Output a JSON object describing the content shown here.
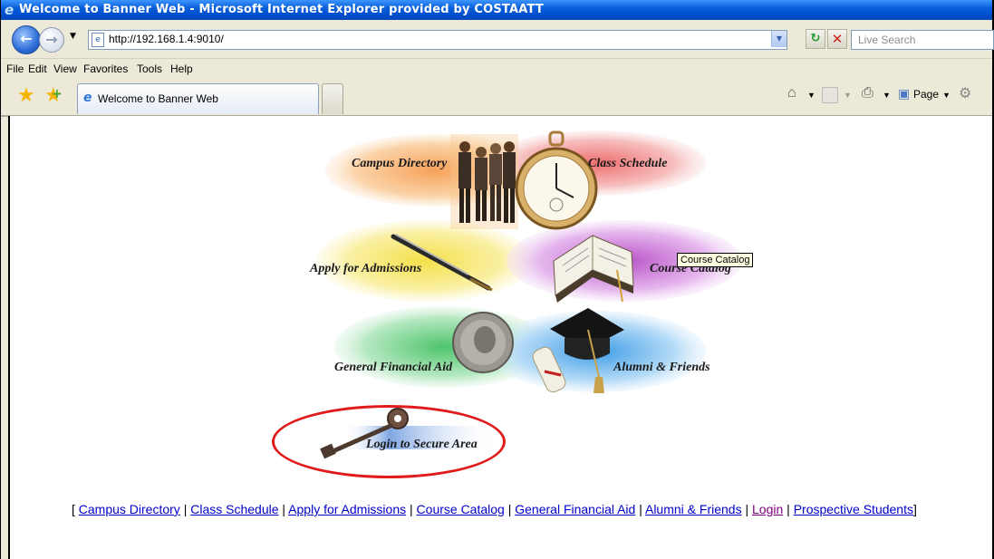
{
  "window": {
    "title": "Welcome to Banner Web - Microsoft Internet Explorer provided by COSTAATT"
  },
  "address_bar": {
    "url": "http://192.168.1.4:9010/"
  },
  "search": {
    "placeholder": "Live Search"
  },
  "menu": [
    {
      "label": "File"
    },
    {
      "label": "Edit"
    },
    {
      "label": "View"
    },
    {
      "label": "Favorites"
    },
    {
      "label": "Tools"
    },
    {
      "label": "Help"
    }
  ],
  "tab": {
    "label": "Welcome to Banner Web"
  },
  "toolbar": {
    "page_label": "Page"
  },
  "main": {
    "tiles": {
      "campus_directory": "Campus Directory",
      "class_schedule": "Class Schedule",
      "apply_admissions": "Apply for Admissions",
      "course_catalog": "Course Catalog",
      "general_financial_aid": "General Financial Aid",
      "alumni_friends": "Alumni & Friends",
      "login": "Login to Secure Area"
    },
    "tooltip": "Course Catalog"
  },
  "footer_links": {
    "open_bracket": "[ ",
    "close_bracket": "]",
    "separator": " | ",
    "items": [
      {
        "label": "Campus Directory"
      },
      {
        "label": "Class Schedule"
      },
      {
        "label": "Apply for Admissions"
      },
      {
        "label": "Course Catalog"
      },
      {
        "label": "General Financial Aid"
      },
      {
        "label": "Alumni & Friends"
      },
      {
        "label": "Login"
      },
      {
        "label": "Prospective Students"
      }
    ]
  },
  "colors": {
    "title_bar": "#0a5fd8",
    "link": "#0000cc",
    "visited_link": "#800080",
    "highlight_oval": "#e01b1b"
  }
}
